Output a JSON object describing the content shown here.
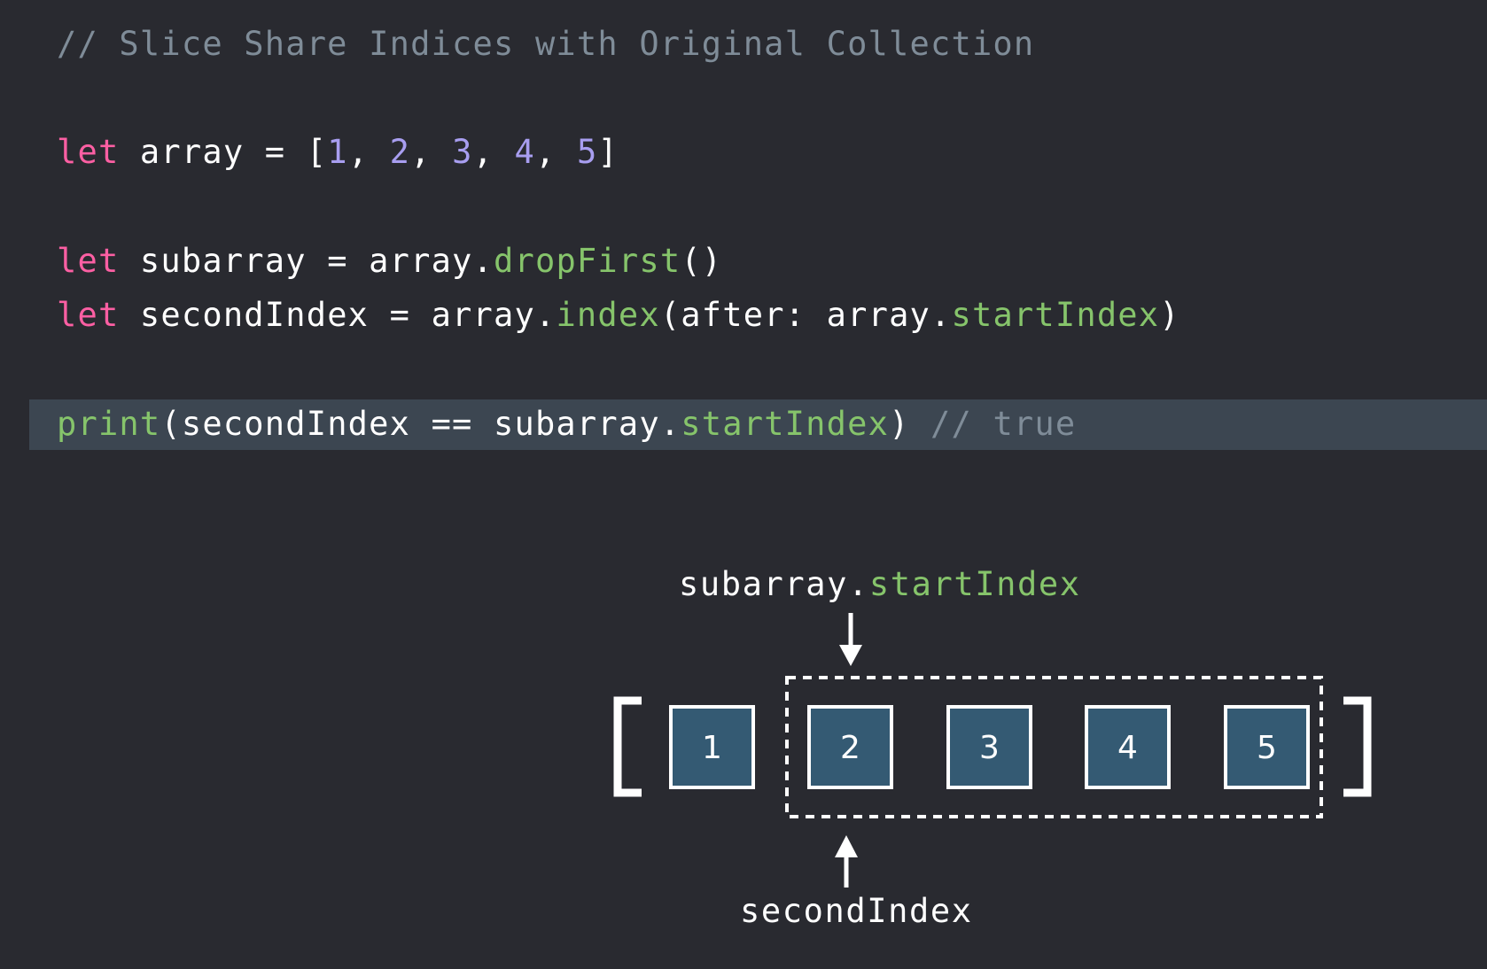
{
  "code": {
    "comment_line": "// Slice Share Indices with Original Collection",
    "line_array": {
      "kw": "let",
      "name": " array = [",
      "values": [
        "1",
        "2",
        "3",
        "4",
        "5"
      ],
      "sep": ", ",
      "close": "]"
    },
    "line_subarray": {
      "kw": "let",
      "plain1": " subarray = array.",
      "fn": "dropFirst",
      "plain2": "()"
    },
    "line_second": {
      "kw": "let",
      "plain1": " secondIndex = array.",
      "fn1": "index",
      "plain2": "(after: array.",
      "fn2": "startIndex",
      "plain3": ")"
    },
    "line_print": {
      "fn1": "print",
      "plain1": "(secondIndex == subarray.",
      "fn2": "startIndex",
      "plain2": ") ",
      "comment": "// true"
    }
  },
  "diagram": {
    "top_label_plain": "subarray.",
    "top_label_fn": "startIndex",
    "bottom_label": "secondIndex",
    "elements": [
      "1",
      "2",
      "3",
      "4",
      "5"
    ],
    "colors": {
      "box_fill": "#345a73",
      "stroke": "#ffffff"
    }
  }
}
